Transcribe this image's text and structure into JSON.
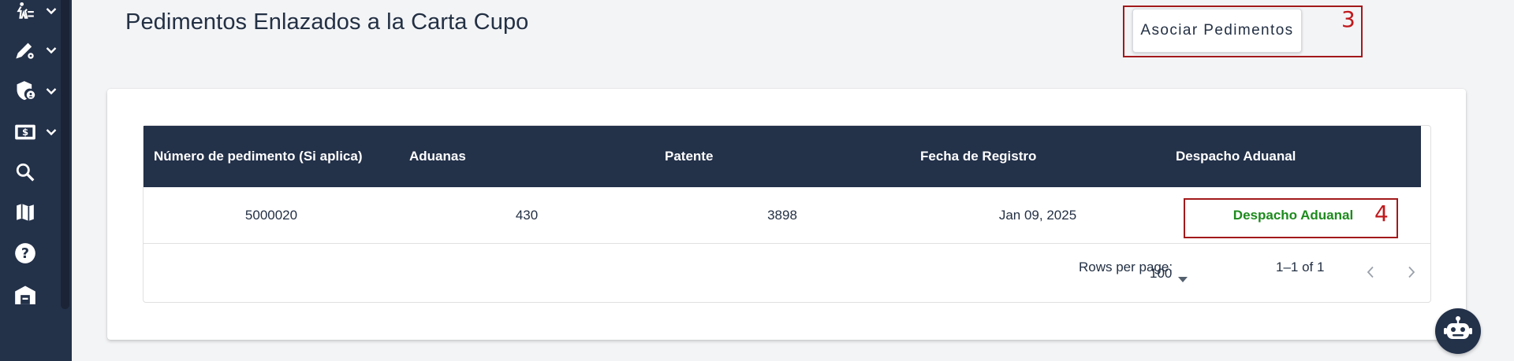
{
  "sidebar": {
    "items": [
      {
        "icon": "person-hierarchy-icon",
        "has_chevron": true
      },
      {
        "icon": "edit-settings-icon",
        "has_chevron": true
      },
      {
        "icon": "shield-user-icon",
        "has_chevron": true
      },
      {
        "icon": "money-icon",
        "has_chevron": true
      },
      {
        "icon": "search-icon",
        "has_chevron": false
      },
      {
        "icon": "map-icon",
        "has_chevron": false
      },
      {
        "icon": "help-icon",
        "has_chevron": false
      },
      {
        "icon": "warehouse-icon",
        "has_chevron": false
      }
    ]
  },
  "header": {
    "title": "Pedimentos Enlazados a la Carta Cupo",
    "associate_button": "Asociar Pedimentos"
  },
  "annotations": {
    "button_marker": "3",
    "link_marker": "4",
    "color": "#a3191b"
  },
  "table": {
    "columns": [
      "Número de pedimento (Si aplica)",
      "Aduanas",
      "Patente",
      "Fecha de Registro",
      "Despacho Aduanal"
    ],
    "rows": [
      {
        "numero": "5000020",
        "aduanas": "430",
        "patente": "3898",
        "fecha": "Jan 09, 2025",
        "despacho": "Despacho Aduanal"
      }
    ]
  },
  "pagination": {
    "rows_per_page_label": "Rows per page:",
    "rows_per_page_value": "100",
    "range_text": "1–1 of 1"
  },
  "colors": {
    "sidebar_bg": "#233149",
    "header_bg": "#233149",
    "link_green": "#1d8a1d",
    "text": "#233044"
  },
  "chat_bot": {
    "icon": "robot-icon"
  }
}
